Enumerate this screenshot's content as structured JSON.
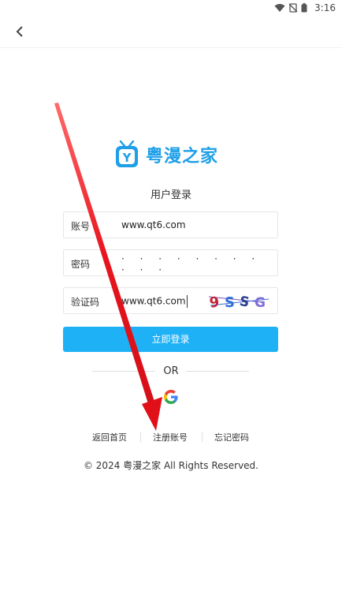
{
  "status": {
    "time": "3:16"
  },
  "logo": {
    "text": "粤漫之家",
    "badge": "Y"
  },
  "page": {
    "subtitle": "用户登录"
  },
  "form": {
    "account": {
      "label": "账号",
      "value": "www.qt6.com"
    },
    "password": {
      "label": "密码",
      "value": "· · · · · · · · · · ·"
    },
    "captcha": {
      "label": "验证码",
      "value": "www.qt6.com",
      "image_text": "9SSG"
    },
    "submit_label": "立即登录"
  },
  "divider": {
    "text": "OR"
  },
  "links": {
    "home": "返回首页",
    "register": "注册账号",
    "forgot": "忘记密码"
  },
  "footer": {
    "copyright": "© 2024 粤漫之家 All Rights Reserved."
  },
  "colors": {
    "accent": "#1fb1f6",
    "brand": "#1e9fe8",
    "annotation_arrow": "#e8141e"
  },
  "icons": [
    "wifi-icon",
    "no-sim-icon",
    "battery-icon",
    "back-arrow-icon",
    "tv-logo-icon",
    "google-icon",
    "red-annotation-arrow"
  ]
}
